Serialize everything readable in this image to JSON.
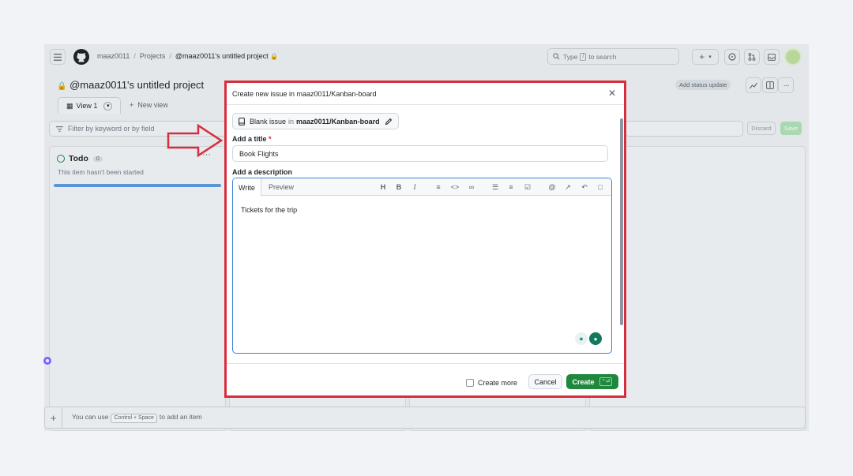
{
  "topbar": {
    "owner": "maaz0011",
    "projects": "Projects",
    "project_name": "@maaz0011's untitled project",
    "search_placeholder_pre": "Type",
    "search_key": "/",
    "search_placeholder_post": "to search"
  },
  "project": {
    "title": "@maaz0011's untitled project",
    "view_tab": "View 1",
    "new_view": "New view",
    "status_update": "Add status update",
    "filter_placeholder": "Filter by keyword or by field",
    "discard": "Discard",
    "save": "Save"
  },
  "board": {
    "column_name": "Todo",
    "column_count": "0",
    "column_subtitle": "This item hasn't been started",
    "add_item_pre": "You can use",
    "add_item_key": "Control + Space",
    "add_item_post": "to add an item"
  },
  "dialog": {
    "title": "Create new issue in maaz0011/Kanban-board",
    "template_label": "Blank issue",
    "template_in": "in",
    "template_repo": "maaz0011/Kanban-board",
    "title_label": "Add a title",
    "required_mark": "*",
    "title_value": "Book Flights",
    "description_label": "Add a description",
    "write_tab": "Write",
    "preview_tab": "Preview",
    "description_value": "Tickets for the trip",
    "create_more": "Create more",
    "cancel": "Cancel",
    "create": "Create",
    "create_shortcut": "⌃⏎"
  },
  "colors": {
    "accent": "#1f883d",
    "highlight_border": "#d62e3c",
    "focus": "#3c84d2"
  }
}
